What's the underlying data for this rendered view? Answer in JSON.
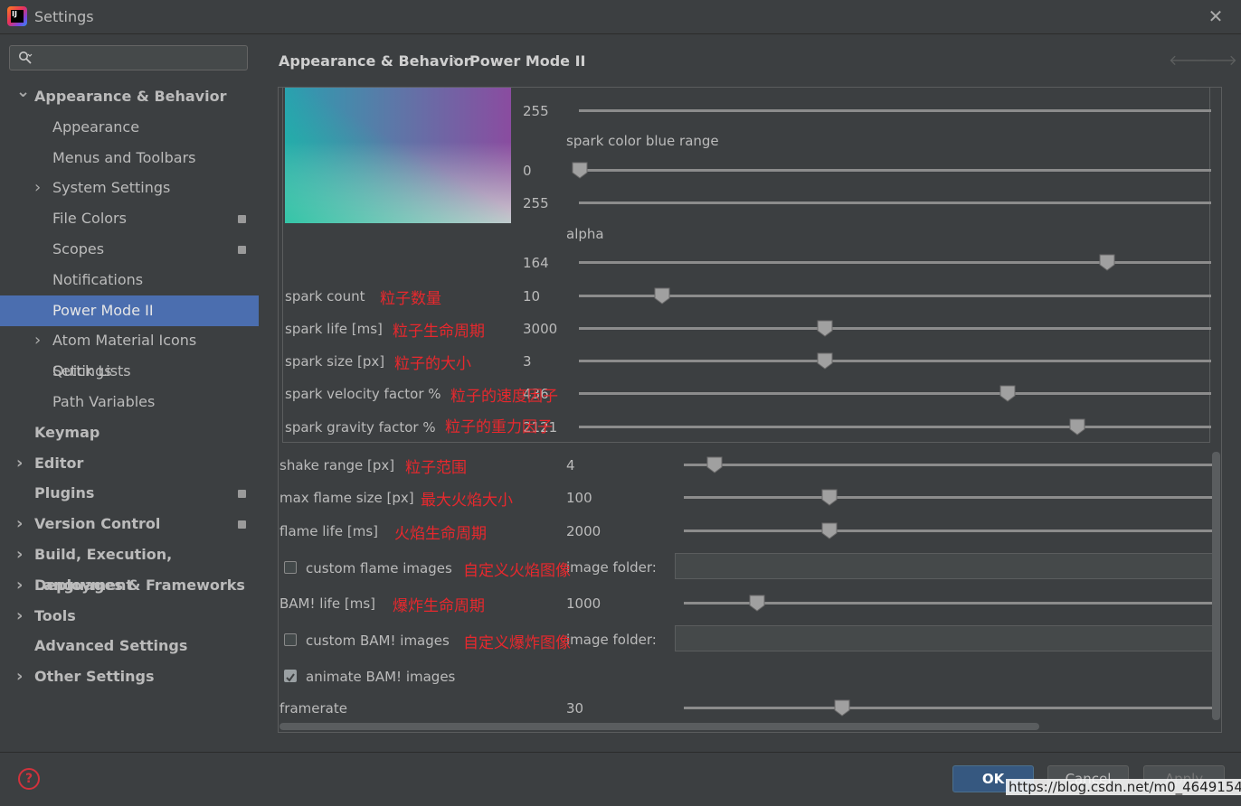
{
  "window": {
    "title": "Settings",
    "close_glyph": "✕",
    "logo_text": "IJ"
  },
  "search": {
    "placeholder": ""
  },
  "sidebar": {
    "items": [
      {
        "label": "Appearance & Behavior",
        "level": 0,
        "bold": true,
        "chevron": "expanded"
      },
      {
        "label": "Appearance",
        "level": 1
      },
      {
        "label": "Menus and Toolbars",
        "level": 1
      },
      {
        "label": "System Settings",
        "level": 1,
        "chevron": "collapsed"
      },
      {
        "label": "File Colors",
        "level": 1,
        "badge": true
      },
      {
        "label": "Scopes",
        "level": 1,
        "badge": true
      },
      {
        "label": "Notifications",
        "level": 1
      },
      {
        "label": "Power Mode II",
        "level": 1,
        "selected": true
      },
      {
        "label": "Atom Material Icons Settings",
        "level": 1,
        "chevron": "collapsed"
      },
      {
        "label": "Quick Lists",
        "level": 1
      },
      {
        "label": "Path Variables",
        "level": 1
      },
      {
        "label": "Keymap",
        "level": 0,
        "bold": true
      },
      {
        "label": "Editor",
        "level": 0,
        "bold": true,
        "chevron": "collapsed"
      },
      {
        "label": "Plugins",
        "level": 0,
        "bold": true,
        "badge": true
      },
      {
        "label": "Version Control",
        "level": 0,
        "bold": true,
        "chevron": "collapsed",
        "badge": true
      },
      {
        "label": "Build, Execution, Deployment",
        "level": 0,
        "bold": true,
        "chevron": "collapsed"
      },
      {
        "label": "Languages & Frameworks",
        "level": 0,
        "bold": true,
        "chevron": "collapsed"
      },
      {
        "label": "Tools",
        "level": 0,
        "bold": true,
        "chevron": "collapsed"
      },
      {
        "label": "Advanced Settings",
        "level": 0,
        "bold": true
      },
      {
        "label": "Other Settings",
        "level": 0,
        "bold": true,
        "chevron": "collapsed"
      }
    ]
  },
  "breadcrumb": {
    "parent": "Appearance & Behavior",
    "separator": "›",
    "current": "Power Mode II",
    "back_glyph": "🡐",
    "forward_glyph": "🡒"
  },
  "color_section": {
    "green_max_value": "255",
    "blue_label": "spark color blue range",
    "blue_min_value": "0",
    "blue_max_value": "255",
    "alpha_label": "alpha",
    "alpha_value": "164"
  },
  "sliders": {
    "spark_count": {
      "label": "spark count",
      "note": "粒子数量",
      "value": "10"
    },
    "spark_life": {
      "label": "spark life [ms]",
      "note": "粒子生命周期",
      "value": "3000"
    },
    "spark_size": {
      "label": "spark size [px]",
      "note": "粒子的大小",
      "value": "3"
    },
    "spark_velocity": {
      "label": "spark velocity factor %",
      "note": "粒子的速度因子",
      "value": "436"
    },
    "spark_gravity": {
      "label": "spark gravity factor %",
      "note": "粒子的重力因子",
      "value": "2121"
    },
    "shake_range": {
      "label": "shake range [px]",
      "note": "粒子范围",
      "value": "4"
    },
    "max_flame_size": {
      "label": "max flame size [px]",
      "note": "最大火焰大小",
      "value": "100"
    },
    "flame_life": {
      "label": "flame life [ms]",
      "note": "火焰生命周期",
      "value": "2000"
    },
    "bam_life": {
      "label": "BAM! life [ms]",
      "note": "爆炸生命周期",
      "value": "1000"
    },
    "framerate": {
      "label": "framerate",
      "value": "30"
    }
  },
  "checkboxes": {
    "custom_flame": {
      "label": "custom flame images",
      "note": "自定义火焰图像",
      "checked": false,
      "folder_label": "image folder:",
      "folder_value": ""
    },
    "custom_bam": {
      "label": "custom BAM! images",
      "note": "自定义爆炸图像",
      "checked": false,
      "folder_label": "image folder:",
      "folder_value": ""
    },
    "animate_bam": {
      "label": "animate BAM! images",
      "checked": true
    }
  },
  "footer": {
    "help_glyph": "?",
    "ok_label": "OK",
    "cancel_label": "Cancel",
    "apply_label": "Apply"
  },
  "watermark": "https://blog.csdn.net/m0_46491549",
  "colors": {
    "selection": "#4b6eaf",
    "ok_button": "#365880",
    "annotation": "#e8282d",
    "background": "#3c3f41"
  }
}
